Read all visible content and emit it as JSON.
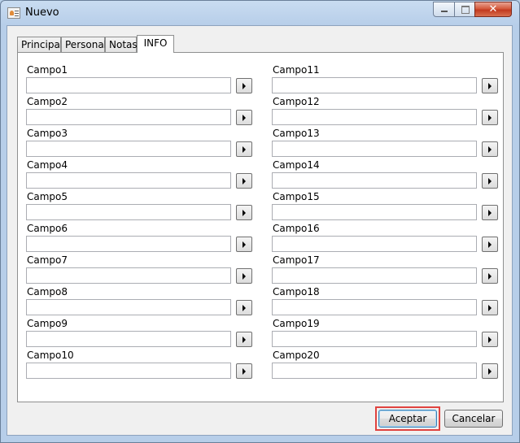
{
  "window": {
    "title": "Nuevo",
    "close_glyph": "✕"
  },
  "tabs": [
    {
      "label": "Principal"
    },
    {
      "label": "Personal"
    },
    {
      "label": "Notas"
    },
    {
      "label": "INFO"
    }
  ],
  "active_tab": "INFO",
  "fields_left": [
    {
      "label": "Campo1",
      "value": ""
    },
    {
      "label": "Campo2",
      "value": ""
    },
    {
      "label": "Campo3",
      "value": ""
    },
    {
      "label": "Campo4",
      "value": ""
    },
    {
      "label": "Campo5",
      "value": ""
    },
    {
      "label": "Campo6",
      "value": ""
    },
    {
      "label": "Campo7",
      "value": ""
    },
    {
      "label": "Campo8",
      "value": ""
    },
    {
      "label": "Campo9",
      "value": ""
    },
    {
      "label": "Campo10",
      "value": ""
    }
  ],
  "fields_right": [
    {
      "label": "Campo11",
      "value": ""
    },
    {
      "label": "Campo12",
      "value": ""
    },
    {
      "label": "Campo13",
      "value": ""
    },
    {
      "label": "Campo14",
      "value": ""
    },
    {
      "label": "Campo15",
      "value": ""
    },
    {
      "label": "Campo16",
      "value": ""
    },
    {
      "label": "Campo17",
      "value": ""
    },
    {
      "label": "Campo18",
      "value": ""
    },
    {
      "label": "Campo19",
      "value": ""
    },
    {
      "label": "Campo20",
      "value": ""
    }
  ],
  "buttons": {
    "ok": "Aceptar",
    "cancel": "Cancelar"
  },
  "colors": {
    "highlight": "#e0433f",
    "title_bg": "#b9d1ea",
    "close_red": "#c23a1f"
  }
}
